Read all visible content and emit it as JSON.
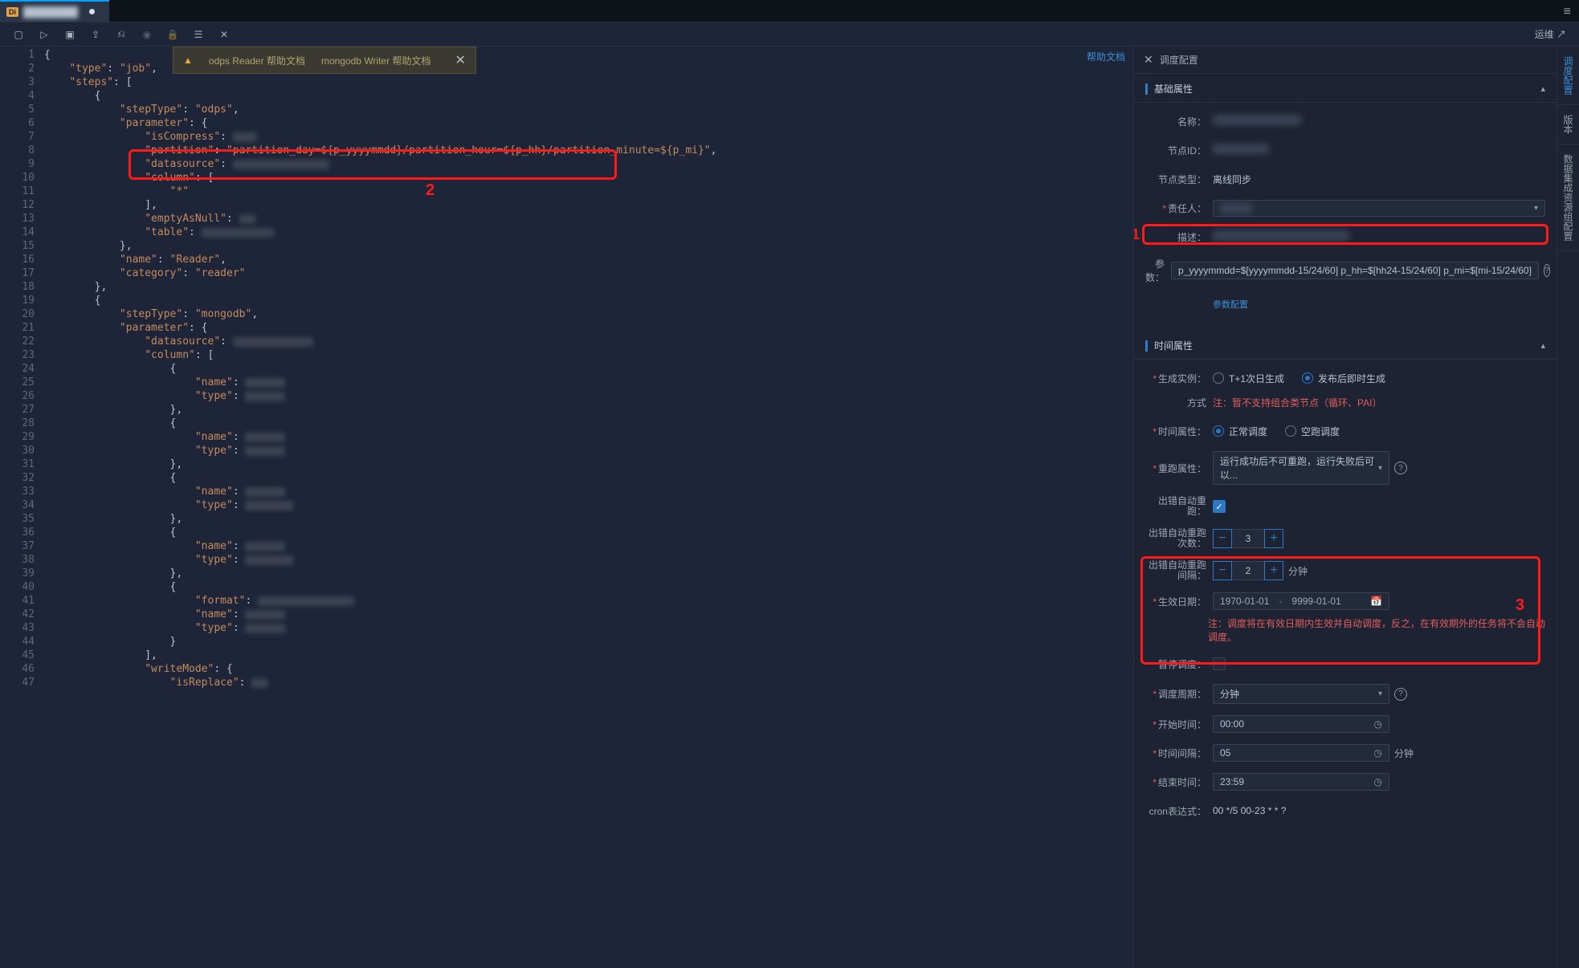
{
  "tab": {
    "badge": "Di",
    "name_blurred": true,
    "modified": true
  },
  "topbar": {
    "hamburger": "≡"
  },
  "toolbar": {
    "icons": [
      "save-icon",
      "play-icon",
      "run-dev-icon",
      "upload-icon",
      "format-icon",
      "stop-icon",
      "lock-icon",
      "lineage-icon",
      "wrench-icon"
    ],
    "right_link": "运维 ↗"
  },
  "help_banner": {
    "reader": "odps Reader 帮助文档",
    "writer": "mongodb Writer 帮助文档"
  },
  "help_doc": "帮助文档",
  "annotations": {
    "one": "1",
    "two": "2",
    "three": "3"
  },
  "code": {
    "lines": [
      "{",
      "    \"type\": \"job\",",
      "    \"steps\": [",
      "        {",
      "            \"stepType\": \"odps\",",
      "            \"parameter\": {",
      "                \"isCompress\":",
      "                \"partition\": \"partition_day=${p_yyyymmdd}/partition_hour=${p_hh}/partition_minute=${p_mi}\",",
      "                \"datasource\":",
      "                \"column\": [",
      "                    \"*\"",
      "                ],",
      "                \"emptyAsNull\":",
      "                \"table\":",
      "            },",
      "            \"name\": \"Reader\",",
      "            \"category\": \"reader\"",
      "        },",
      "        {",
      "            \"stepType\": \"mongodb\",",
      "            \"parameter\": {",
      "                \"datasource\":",
      "                \"column\": [",
      "                    {",
      "                        \"name\":",
      "                        \"type\":",
      "                    },",
      "                    {",
      "                        \"name\":",
      "                        \"type\":",
      "                    },",
      "                    {",
      "                        \"name\":",
      "                        \"type\":",
      "                    },",
      "                    {",
      "                        \"name\":",
      "                        \"type\":",
      "                    },",
      "                    {",
      "                        \"format\":",
      "                        \"name\":",
      "                        \"type\":",
      "                    }",
      "                ],",
      "                \"writeMode\": {",
      "                    \"isReplace\":"
    ]
  },
  "panel": {
    "title": "调度配置",
    "sections": {
      "basic": {
        "title": "基础属性",
        "name_label": "名称：",
        "node_id_label": "节点ID：",
        "node_type_label": "节点类型：",
        "node_type_value": "离线同步",
        "owner_label": "责任人：",
        "desc_label": "描述：",
        "params_label": "参数：",
        "params_value": "p_yyyymmdd=$[yyyymmdd-15/24/60] p_hh=$[hh24-15/24/60] p_mi=$[mi-15/24/60]",
        "params_config_link": "参数配置"
      },
      "time": {
        "title": "时间属性",
        "gen_label": "生成实例：",
        "gen_opt1": "T+1次日生成",
        "gen_opt2": "发布后即时生成",
        "gen_note_label": "方式",
        "gen_note": "注：暂不支持组合类节点（循环、PAI）",
        "time_attr_label": "时间属性：",
        "time_opt1": "正常调度",
        "time_opt2": "空跑调度",
        "rerun_label": "重跑属性：",
        "rerun_value": "运行成功后不可重跑，运行失败后可以...",
        "auto_rerun_label": "出错自动重跑：",
        "rerun_count_label": "出错自动重跑次数：",
        "rerun_count": "3",
        "rerun_interval_label": "出错自动重跑间隔：",
        "rerun_interval": "2",
        "minutes_suffix": "分钟",
        "effective_label": "生效日期：",
        "date_from": "1970-01-01",
        "date_to": "9999-01-01",
        "date_note": "注：调度将在有效日期内生效并自动调度，反之，在有效期外的任务将不会自动调度。",
        "pause_label": "暂停调度：",
        "cycle_label": "调度周期：",
        "cycle_value": "分钟",
        "start_label": "开始时间：",
        "start_value": "00:00",
        "interval_label": "时间间隔：",
        "interval_value": "05",
        "end_label": "结束时间：",
        "end_value": "23:59",
        "cron_label": "cron表达式：",
        "cron_value": "00 */5 00-23 * * ?"
      }
    }
  },
  "right_tabs": {
    "t1": "调度配置",
    "t2": "版本",
    "t3": "数据集成资源组配置"
  }
}
